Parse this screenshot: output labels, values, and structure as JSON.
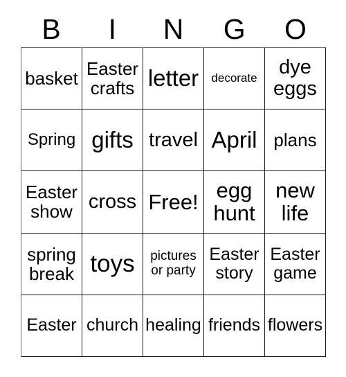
{
  "card": {
    "header_letters": [
      "B",
      "I",
      "N",
      "G",
      "O"
    ],
    "columns": 5,
    "rows": 5,
    "free_space_label": "Free!",
    "colors": {
      "background": "#ffffff",
      "text": "#000000",
      "grid_line": "#1a1a1a"
    },
    "cells": [
      [
        {
          "text": "basket",
          "size": "fs-l"
        },
        {
          "text": "Easter\ncrafts",
          "size": "fs-l"
        },
        {
          "text": "letter",
          "size": "fs-huge"
        },
        {
          "text": "decorate",
          "size": "fs-xs"
        },
        {
          "text": "dye\neggs",
          "size": "fs-xl"
        }
      ],
      [
        {
          "text": "Spring",
          "size": "fs-m"
        },
        {
          "text": "gifts",
          "size": "fs-huge"
        },
        {
          "text": "travel",
          "size": "fs-xl"
        },
        {
          "text": "April",
          "size": "fs-huge"
        },
        {
          "text": "plans",
          "size": "fs-l"
        }
      ],
      [
        {
          "text": "Easter\nshow",
          "size": "fs-l"
        },
        {
          "text": "cross",
          "size": "fs-xl"
        },
        {
          "text": "Free!",
          "size": "fs-xxl"
        },
        {
          "text": "egg\nhunt",
          "size": "fs-xxl"
        },
        {
          "text": "new\nlife",
          "size": "fs-xxl"
        }
      ],
      [
        {
          "text": "spring\nbreak",
          "size": "fs-l"
        },
        {
          "text": "toys",
          "size": "fs-mega"
        },
        {
          "text": "pictures\nor party",
          "size": "fs-s"
        },
        {
          "text": "Easter\nstory",
          "size": "fs-m2"
        },
        {
          "text": "Easter\ngame",
          "size": "fs-m2"
        }
      ],
      [
        {
          "text": "Easter",
          "size": "fs-m2"
        },
        {
          "text": "church",
          "size": "fs-m2"
        },
        {
          "text": "healing",
          "size": "fs-m2"
        },
        {
          "text": "friends",
          "size": "fs-m2"
        },
        {
          "text": "flowers",
          "size": "fs-m2"
        }
      ]
    ]
  }
}
